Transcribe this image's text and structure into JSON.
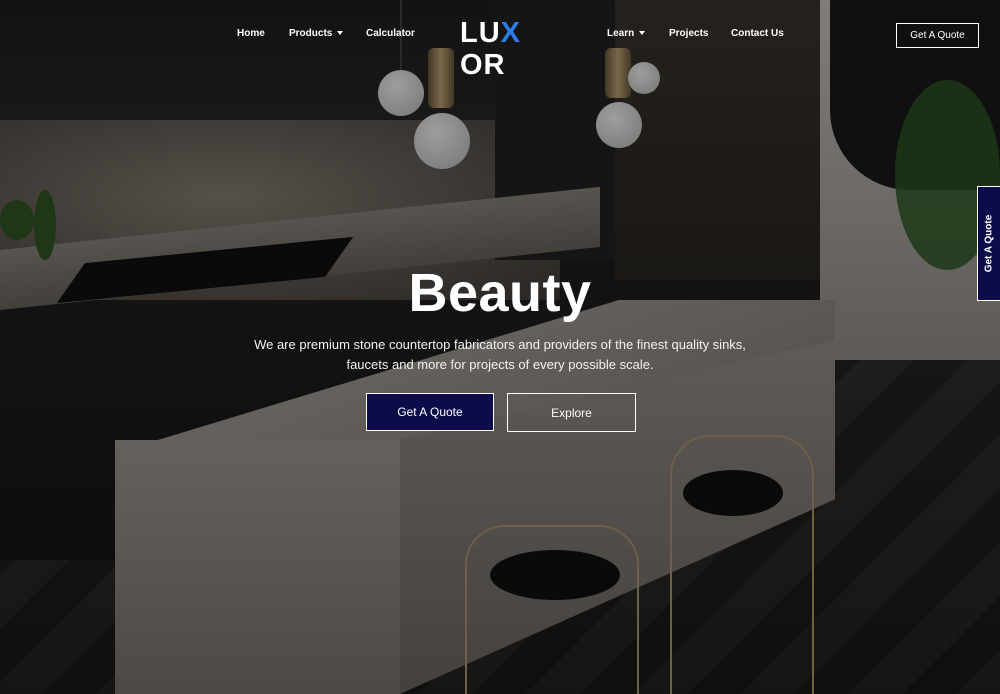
{
  "brand": {
    "logo_text_left": "LU",
    "logo_text_x": "X",
    "logo_text_right": "OR",
    "accent_color": "#2d7fe6"
  },
  "nav": {
    "items": [
      {
        "label": "Home"
      },
      {
        "label": "Products",
        "has_dropdown": true
      },
      {
        "label": "Calculator"
      },
      {
        "label": "Learn",
        "has_dropdown": true
      },
      {
        "label": "Projects"
      },
      {
        "label": "Contact Us"
      }
    ],
    "cta_label": "Get A Quote"
  },
  "hero": {
    "title": "Beauty",
    "description": "We are premium stone countertop fabricators and providers of the finest quality sinks, faucets and more for projects of every possible scale.",
    "primary_button": "Get A Quote",
    "secondary_button": "Explore",
    "primary_color": "#0c0c4a"
  },
  "side_tab": {
    "label": "Get A Quote"
  },
  "icons": [
    "chevron-down-icon"
  ]
}
